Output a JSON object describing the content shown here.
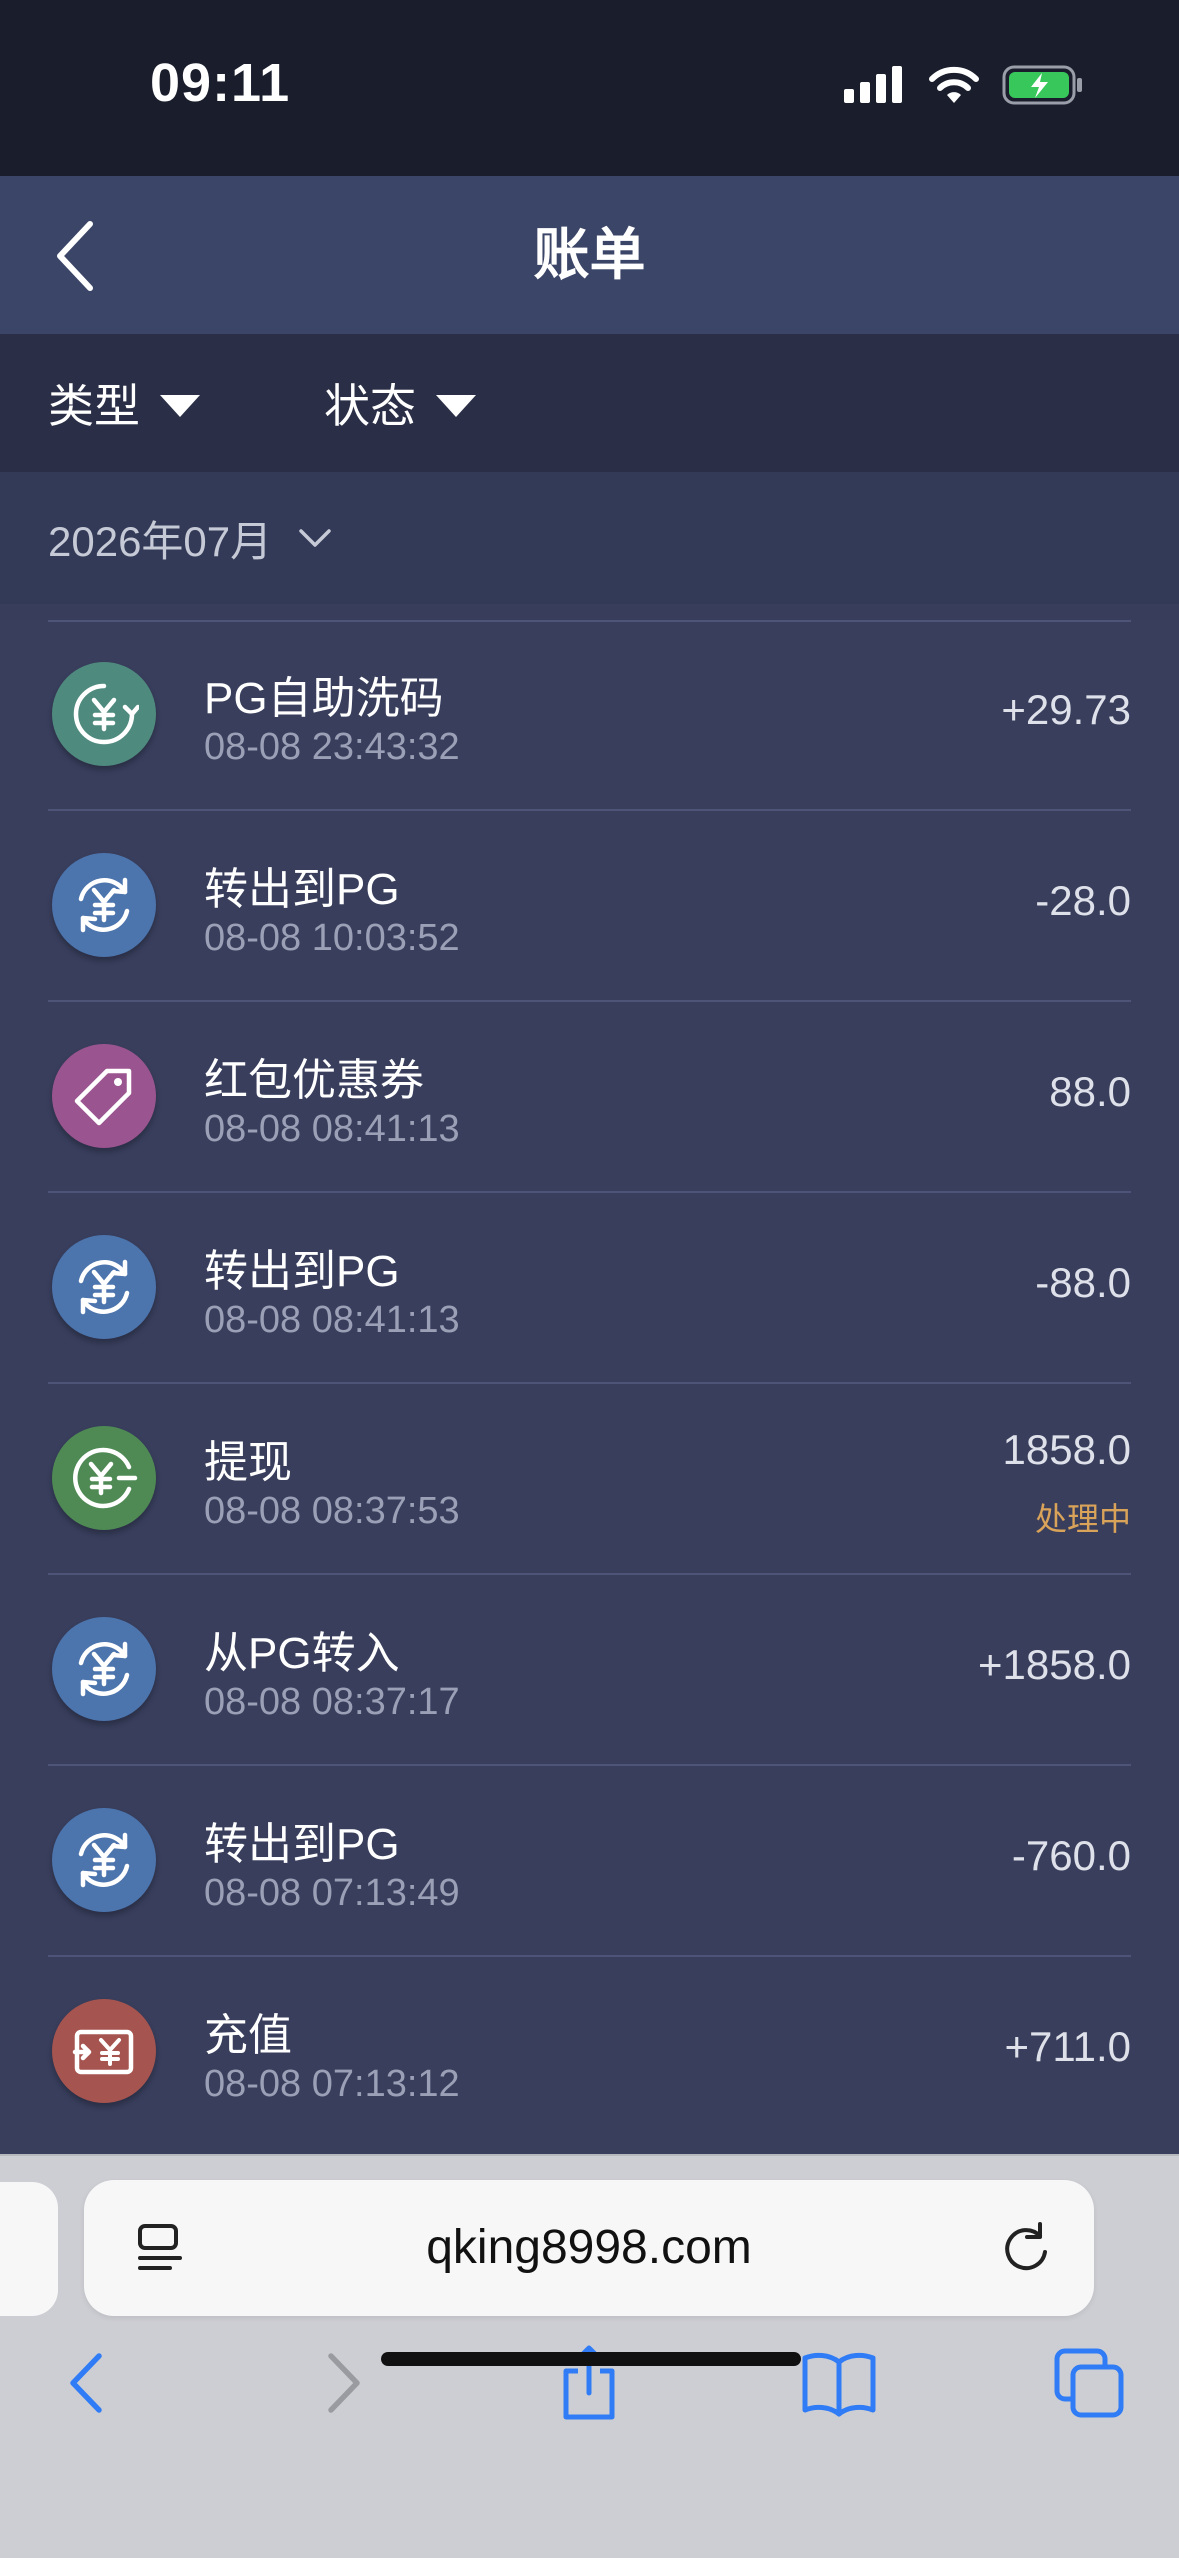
{
  "status_bar": {
    "time": "09:11"
  },
  "header": {
    "title": "账单"
  },
  "filters": {
    "type_label": "类型",
    "status_label": "状态"
  },
  "month": {
    "label": "2026年07月"
  },
  "transactions": [
    {
      "title": "PG自助洗码",
      "time": "08-08 23:43:32",
      "amount": "+29.73",
      "status": "",
      "icon": "rebate-yuan-icon",
      "color": "#4f8a7e"
    },
    {
      "title": "转出到PG",
      "time": "08-08 10:03:52",
      "amount": "-28.0",
      "status": "",
      "icon": "transfer-yuan-icon",
      "color": "#4c74ad"
    },
    {
      "title": "红包优惠券",
      "time": "08-08 08:41:13",
      "amount": "88.0",
      "status": "",
      "icon": "coupon-tag-icon",
      "color": "#9a548f"
    },
    {
      "title": "转出到PG",
      "time": "08-08 08:41:13",
      "amount": "-88.0",
      "status": "",
      "icon": "transfer-yuan-icon",
      "color": "#4c74ad"
    },
    {
      "title": "提现",
      "time": "08-08 08:37:53",
      "amount": "1858.0",
      "status": "处理中",
      "icon": "withdraw-yuan-icon",
      "color": "#4f8a55"
    },
    {
      "title": "从PG转入",
      "time": "08-08 08:37:17",
      "amount": "+1858.0",
      "status": "",
      "icon": "transfer-yuan-icon",
      "color": "#4c74ad"
    },
    {
      "title": "转出到PG",
      "time": "08-08 07:13:49",
      "amount": "-760.0",
      "status": "",
      "icon": "transfer-yuan-icon",
      "color": "#4c74ad"
    },
    {
      "title": "充值",
      "time": "08-08 07:13:12",
      "amount": "+711.0",
      "status": "",
      "icon": "deposit-yuan-icon",
      "color": "#a6544f"
    }
  ],
  "browser": {
    "url": "qking8998.com"
  },
  "colors": {
    "accent_blue": "#2f7cf6",
    "pending": "#d9a35a",
    "header_bg": "#3b4567",
    "list_bg": "#383e5c"
  }
}
